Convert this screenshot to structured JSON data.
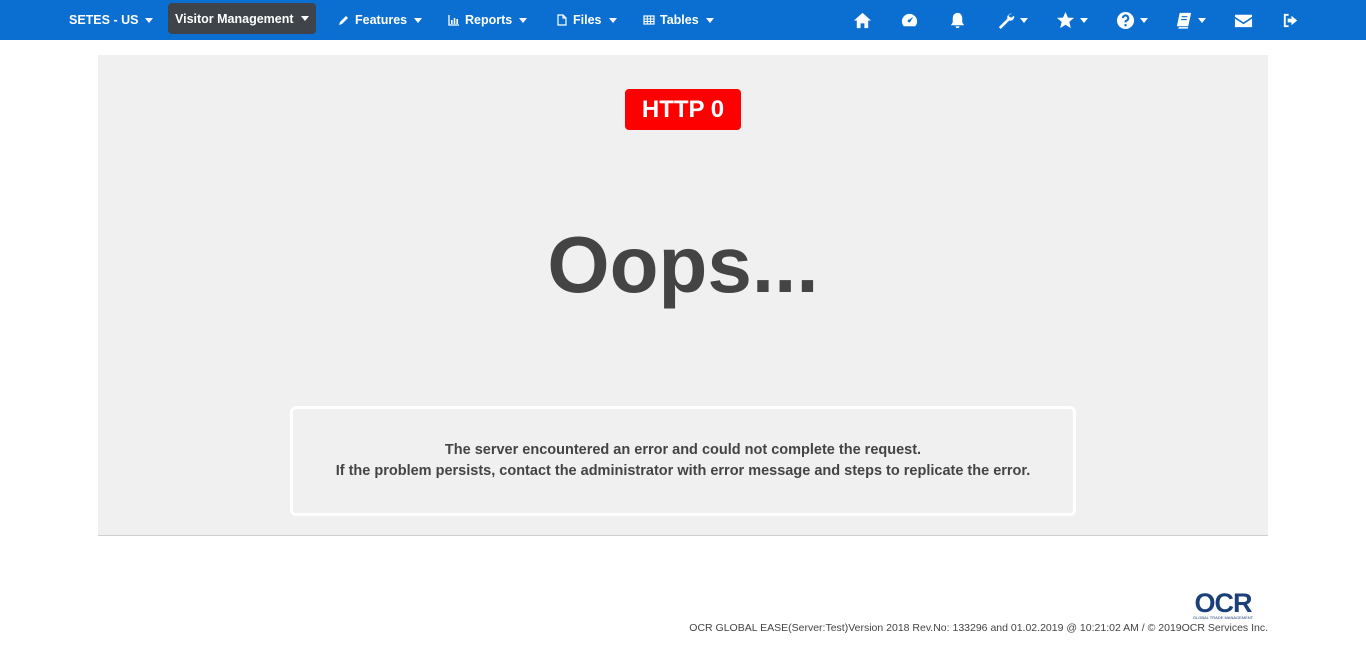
{
  "navbar": {
    "items": [
      {
        "label": "SETES - US",
        "icon": "none"
      },
      {
        "label": "Visitor Management",
        "icon": "none",
        "active": true
      },
      {
        "label": "Features",
        "icon": "pencil-icon"
      },
      {
        "label": "Reports",
        "icon": "bar-chart-icon"
      },
      {
        "label": "Files",
        "icon": "file-icon"
      },
      {
        "label": "Tables",
        "icon": "table-icon"
      }
    ],
    "right_icons": [
      {
        "name": "home-icon",
        "dropdown": false
      },
      {
        "name": "dashboard-icon",
        "dropdown": false
      },
      {
        "name": "bell-icon",
        "dropdown": false
      },
      {
        "name": "wrench-icon",
        "dropdown": true
      },
      {
        "name": "star-icon",
        "dropdown": true
      },
      {
        "name": "question-icon",
        "dropdown": true
      },
      {
        "name": "book-icon",
        "dropdown": true
      },
      {
        "name": "envelope-icon",
        "dropdown": false
      },
      {
        "name": "sign-out-icon",
        "dropdown": false
      }
    ],
    "colors": {
      "background": "#0a6fd1",
      "active": "#3e4449"
    }
  },
  "error": {
    "badge": "HTTP 0",
    "heading": "Oops...",
    "message_line1": "The server encountered an error and could not complete the request.",
    "message_line2": "If the problem persists, contact the administrator with error message and steps to replicate the error.",
    "badge_color": "#ff0000"
  },
  "footer": {
    "logo_text": "OCR",
    "logo_subtext": "GLOBAL TRADE MANAGEMENT",
    "version_text": "OCR GLOBAL EASE(Server:Test)Version 2018 Rev.No: 133296 and 01.02.2019 @ 10:21:02 AM   /   © 2019OCR Services Inc."
  }
}
